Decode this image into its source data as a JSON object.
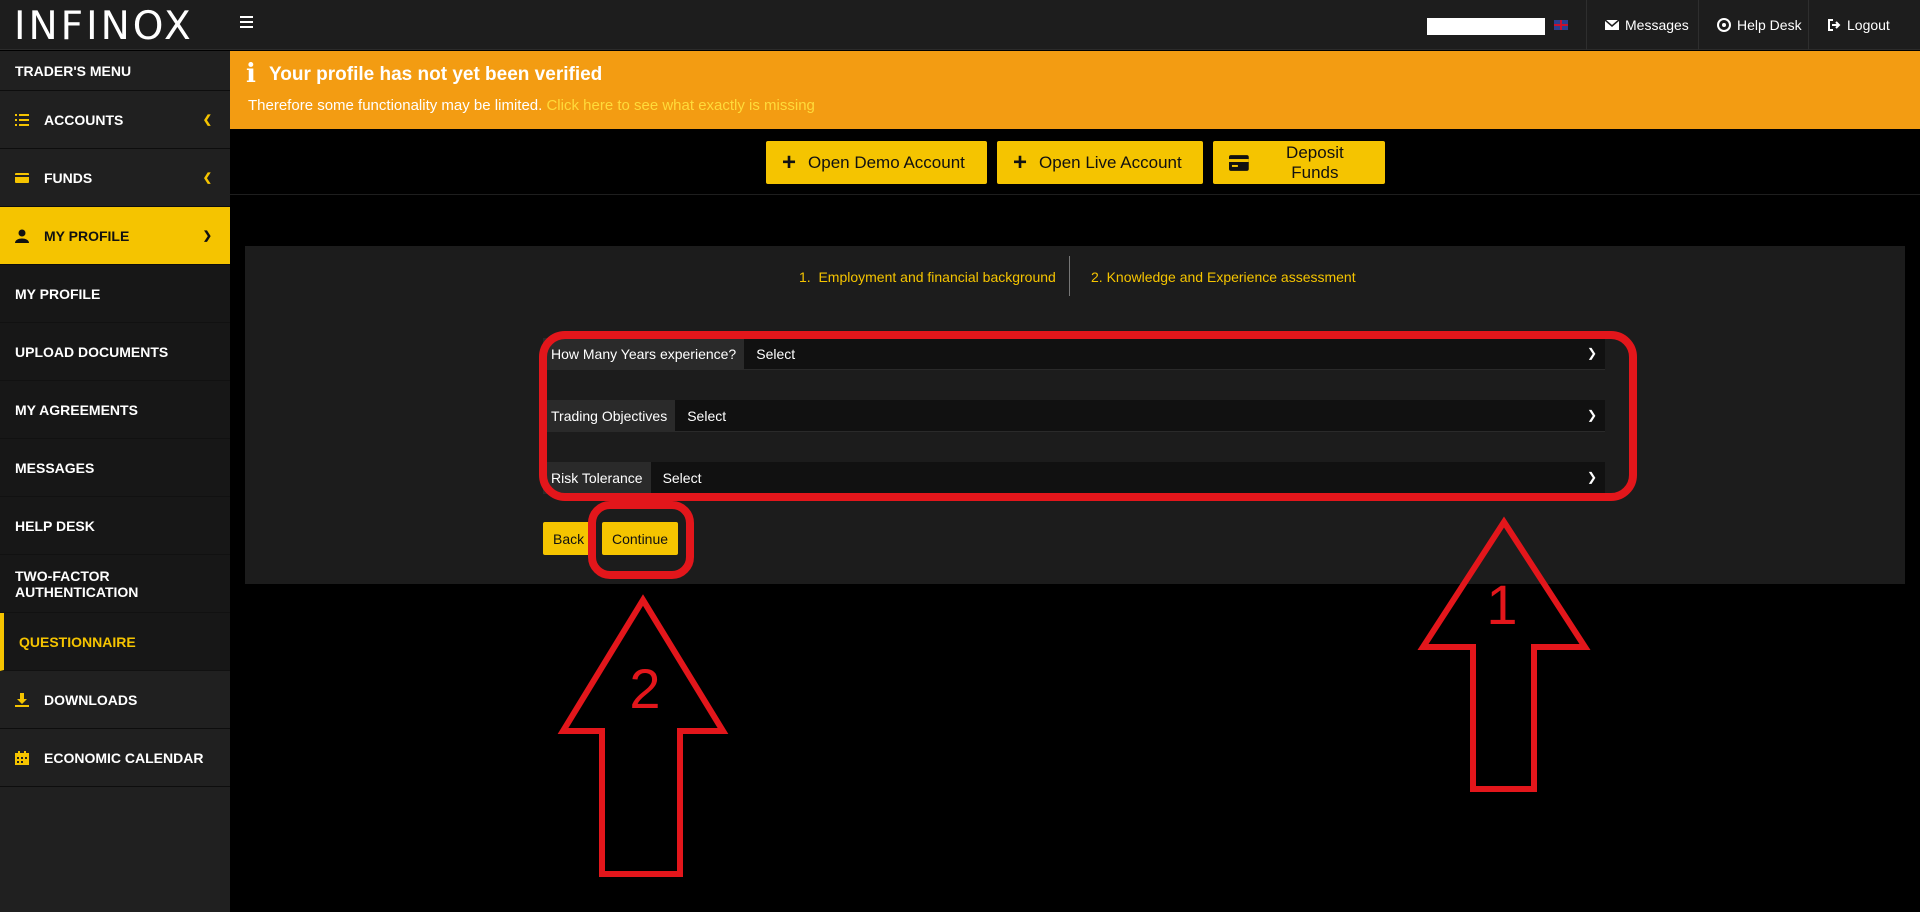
{
  "header": {
    "logo": "INFINOX",
    "nav": {
      "messages": "Messages",
      "help_desk": "Help Desk",
      "logout": "Logout"
    }
  },
  "sidebar": {
    "title": "TRADER'S MENU",
    "accounts": "ACCOUNTS",
    "funds": "FUNDS",
    "my_profile": "MY PROFILE",
    "sub": {
      "my_profile": "MY PROFILE",
      "upload_documents": "UPLOAD DOCUMENTS",
      "my_agreements": "MY AGREEMENTS",
      "messages": "MESSAGES",
      "help_desk": "HELP DESK",
      "two_factor": "TWO-FACTOR AUTHENTICATION",
      "questionnaire": "QUESTIONNAIRE"
    },
    "downloads": "DOWNLOADS",
    "economic_calendar": "ECONOMIC CALENDAR"
  },
  "banner": {
    "title": "Your profile has not yet been verified",
    "text": "Therefore some functionality may be limited.",
    "link": "Click here to see what exactly is missing"
  },
  "actions": {
    "open_demo": "Open Demo Account",
    "open_live": "Open Live Account",
    "deposit": "Deposit Funds"
  },
  "steps": {
    "step1": "1.  Employment and financial background",
    "step2": "2. Knowledge and Experience assessment"
  },
  "form": {
    "years_label": "How Many Years experience?",
    "years_value": "Select",
    "objectives_label": "Trading Objectives",
    "objectives_value": "Select",
    "risk_label": "Risk Tolerance",
    "risk_value": "Select"
  },
  "buttons": {
    "back": "Back",
    "continue": "Continue"
  },
  "annotations": {
    "one": "1",
    "two": "2"
  },
  "colors": {
    "accent": "#f5c400",
    "banner": "#f39c12",
    "annotation": "#e3161b"
  }
}
